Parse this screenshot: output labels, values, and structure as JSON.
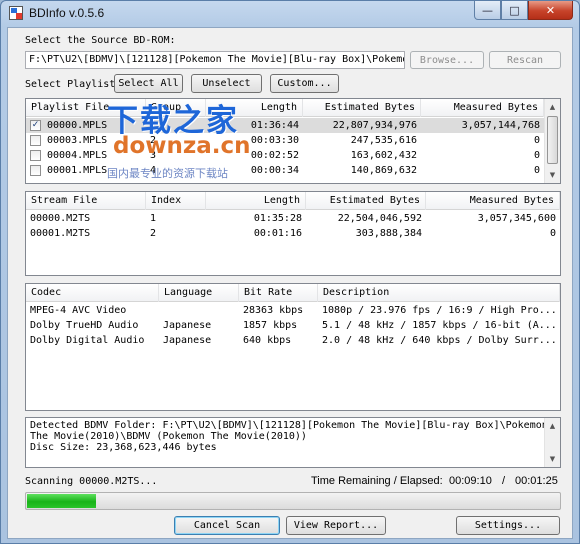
{
  "window": {
    "title": "BDInfo v.0.5.6",
    "controls": {
      "minimize": "—",
      "maximize": "□",
      "close": "✕"
    }
  },
  "source": {
    "label": "Select the Source BD-ROM:",
    "path": "F:\\PT\\U2\\[BDMV]\\[121128][Pokemon The Movie][Blu-ray Box]\\Pokemon T",
    "browse_label": "Browse...",
    "rescan_label": "Rescan"
  },
  "playlist_toolbar": {
    "label": "Select Playlist",
    "select_all": "Select All",
    "unselect": "Unselect",
    "custom": "Custom..."
  },
  "playlists": {
    "columns": [
      "Playlist File",
      "Group",
      "Length",
      "Estimated Bytes",
      "Measured Bytes"
    ],
    "rows": [
      {
        "checked": true,
        "file": "00000.MPLS",
        "group": "1",
        "length": "01:36:44",
        "estimated": "22,807,934,976",
        "measured": "3,057,144,768"
      },
      {
        "checked": false,
        "file": "00003.MPLS",
        "group": "2",
        "length": "00:03:30",
        "estimated": "247,535,616",
        "measured": "0"
      },
      {
        "checked": false,
        "file": "00004.MPLS",
        "group": "3",
        "length": "00:02:52",
        "estimated": "163,602,432",
        "measured": "0"
      },
      {
        "checked": false,
        "file": "00001.MPLS",
        "group": "4",
        "length": "00:00:34",
        "estimated": "140,869,632",
        "measured": "0"
      }
    ]
  },
  "streams": {
    "columns": [
      "Stream File",
      "Index",
      "Length",
      "Estimated Bytes",
      "Measured Bytes"
    ],
    "rows": [
      {
        "file": "00000.M2TS",
        "index": "1",
        "length": "01:35:28",
        "estimated": "22,504,046,592",
        "measured": "3,057,345,600"
      },
      {
        "file": "00001.M2TS",
        "index": "2",
        "length": "00:01:16",
        "estimated": "303,888,384",
        "measured": "0"
      }
    ]
  },
  "codecs": {
    "columns": [
      "Codec",
      "Language",
      "Bit Rate",
      "Description"
    ],
    "rows": [
      {
        "codec": "MPEG-4 AVC Video",
        "language": "",
        "bitrate": "28363 kbps",
        "description": "1080p / 23.976 fps / 16:9 / High Pro..."
      },
      {
        "codec": "Dolby TrueHD Audio",
        "language": "Japanese",
        "bitrate": "1857 kbps",
        "description": "5.1 / 48 kHz / 1857 kbps / 16-bit (A..."
      },
      {
        "codec": "Dolby Digital Audio",
        "language": "Japanese",
        "bitrate": "640 kbps",
        "description": "2.0 / 48 kHz / 640 kbps / Dolby Surr..."
      }
    ]
  },
  "report": {
    "lines": [
      "Detected BDMV Folder: F:\\PT\\U2\\[BDMV]\\[121128][Pokemon The Movie][Blu-ray Box]\\Pokemon",
      "The Movie(2010)\\BDMV (Pokemon The Movie(2010))",
      "Disc Size: 23,368,623,446 bytes"
    ]
  },
  "status": {
    "scanning": "Scanning 00000.M2TS...",
    "time_label": "Time Remaining / Elapsed:",
    "remaining": "00:09:10",
    "slash": "/",
    "elapsed": "00:01:25",
    "progress": 0.13
  },
  "buttons": {
    "cancel_scan": "Cancel Scan",
    "view_report": "View Report...",
    "settings": "Settings..."
  },
  "watermark": {
    "cn": "下载之家",
    "en": "downza.cn",
    "sub": "国内最专业的资源下载站"
  },
  "colors": {
    "progress_green": "#19b419",
    "watermark_blue": "#1e66d8",
    "watermark_orange": "#e0742a",
    "close_red": "#c7432a"
  }
}
